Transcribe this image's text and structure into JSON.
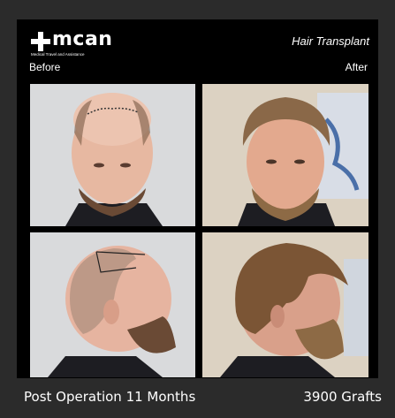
{
  "brand": {
    "name": "mcan",
    "tagline": "Medical Travel and Assistance"
  },
  "header": {
    "title": "Hair Transplant",
    "before_label": "Before",
    "after_label": "After"
  },
  "footer": {
    "duration": "Post Operation 11 Months",
    "grafts": "3900 Grafts"
  },
  "colors": {
    "page_background": "#2b2b2b",
    "frame_background": "#000000",
    "text": "#ffffff"
  }
}
